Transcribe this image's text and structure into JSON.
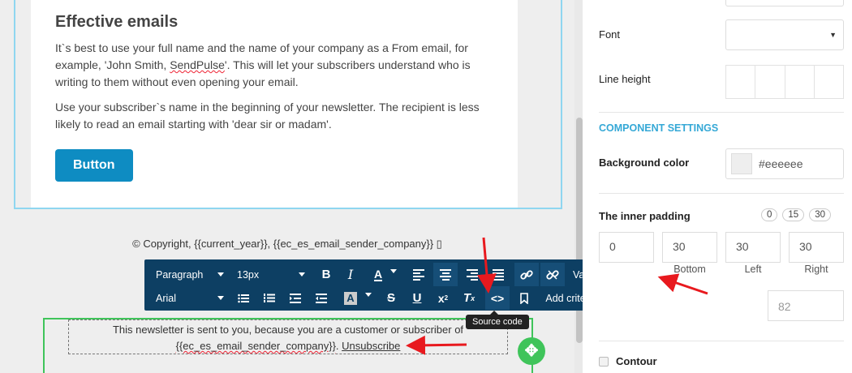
{
  "email": {
    "heading": "Effective emails",
    "p1_before": "It`s best to use your full name and the name of your company as a From email, for example, 'John Smith, ",
    "p1_brand": "SendPulse",
    "p1_after": "'. This will let your subscribers understand who is writing to them without even opening your email.",
    "p2": "Use your subscriber`s name in the beginning of your newsletter. The recipient is less likely to read an email starting with 'dear sir or madam'.",
    "button_label": "Button",
    "copyright": "© Copyright, {{current_year}}, {{ec_es_email_sender_company}} ▯",
    "footer_line1": "This newsletter is sent to you, because you are a customer or subscriber of",
    "footer_var": "{{ec_es_email_sender_company}}",
    "footer_sep": ". ",
    "unsubscribe": "Unsubscribe"
  },
  "toolbar": {
    "paragraph": "Paragraph",
    "font_size": "13px",
    "font_family": "Arial",
    "variables": "Variables",
    "add_criteria": "Add criteria",
    "tooltip": "Source code"
  },
  "panel": {
    "font_label": "Font",
    "line_height_label": "Line height",
    "component_settings": "COMPONENT SETTINGS",
    "bg_color_label": "Background color",
    "bg_color_value": "#eeeeee",
    "inner_padding_label": "The inner padding",
    "presets": [
      "0",
      "15",
      "30"
    ],
    "padding_values": [
      "0",
      "30",
      "30",
      "30"
    ],
    "padding_labels": [
      "Bottom",
      "Left",
      "Right"
    ],
    "extra_value": "82",
    "contour_label": "Contour"
  },
  "colors": {
    "toolbar_bg": "#0d3f63",
    "accent": "#35a8d6",
    "button": "#0e8cc2",
    "selection_green": "#3fc45a",
    "arrow": "#e8191e"
  }
}
